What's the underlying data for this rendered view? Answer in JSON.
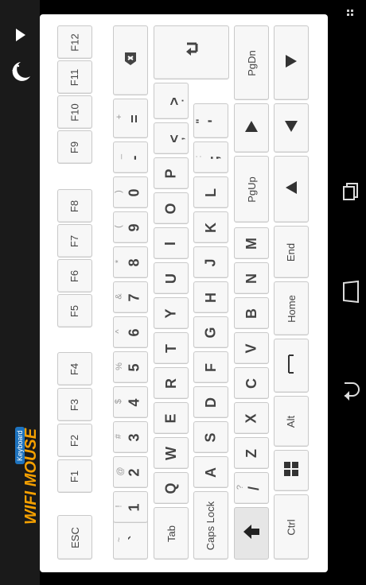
{
  "app": {
    "title": "WIFI MOUSE",
    "badge": "Keyboard"
  },
  "sidebar": {
    "play_icon": "play-icon",
    "night_icon": "moon-stars-icon"
  },
  "nav": {
    "menu_icon": "overflow-menu-icon",
    "recents_icon": "recents-icon",
    "home_icon": "home-icon",
    "back_icon": "back-icon"
  },
  "colors": {
    "brand_orange": "#f5a000",
    "badge_blue": "#1e73be",
    "panel_bg": "#ffffff",
    "key_bg": "#f7f7f7"
  },
  "keys": {
    "esc": "ESC",
    "f1": "F1",
    "f2": "F2",
    "f3": "F3",
    "f4": "F4",
    "f5": "F5",
    "f6": "F6",
    "f7": "F7",
    "f8": "F8",
    "f9": "F9",
    "f10": "F10",
    "f11": "F11",
    "f12": "F12",
    "tilde_main": "`",
    "tilde_sec": "~",
    "n1": "1",
    "n1s": "!",
    "n2": "2",
    "n2s": "@",
    "n3": "3",
    "n3s": "#",
    "n4": "4",
    "n4s": "$",
    "n5": "5",
    "n5s": "%",
    "n6": "6",
    "n6s": "^",
    "n7": "7",
    "n7s": "&",
    "n8": "8",
    "n8s": "*",
    "n9": "9",
    "n9s": "(",
    "n0": "0",
    "n0s": ")",
    "minus": "-",
    "minus_s": "_",
    "equals": "=",
    "equals_s": "+",
    "tab": "Tab",
    "q": "Q",
    "w": "W",
    "e": "E",
    "r": "R",
    "t": "T",
    "y": "Y",
    "u": "U",
    "i": "I",
    "o": "O",
    "p": "P",
    "caps": "Caps Lock",
    "a": "A",
    "s": "S",
    "d": "D",
    "f": "F",
    "g": "G",
    "h": "H",
    "j": "J",
    "k": "K",
    "l": "L",
    "semicolon": ";",
    "semicolon_s": ":",
    "quote": "'",
    "quote_s": "\"",
    "slash": "/",
    "slash_s": "?",
    "z": "Z",
    "x": "X",
    "c": "C",
    "v": "V",
    "b": "B",
    "n": "N",
    "m": "M",
    "lt": "<",
    "lt_s": ",",
    "gt": ">",
    "gt_s": ".",
    "ctrl": "Ctrl",
    "alt": "Alt",
    "space": "___",
    "home": "Home",
    "end": "End",
    "pgup": "PgUp",
    "pgdn": "PgDn"
  }
}
